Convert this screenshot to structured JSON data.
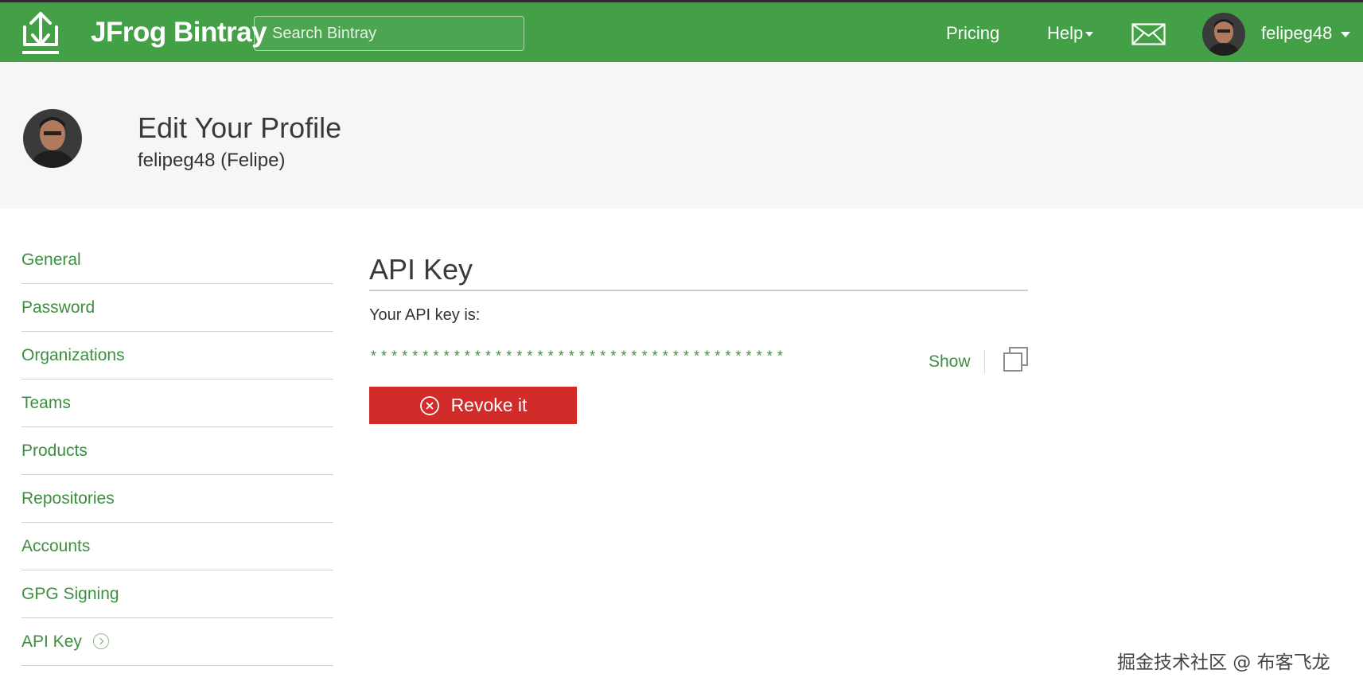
{
  "header": {
    "brand": "JFrog Bintray",
    "search_placeholder": "Search Bintray",
    "pricing": "Pricing",
    "help": "Help",
    "username": "felipeg48",
    "bar_color": "#43a047",
    "icons": [
      "upload-logo-icon",
      "mail-icon",
      "user-avatar",
      "caret-down-icon"
    ]
  },
  "profile": {
    "title": "Edit Your Profile",
    "subtitle": "felipeg48 (Felipe)"
  },
  "sidebar": {
    "items": [
      {
        "label": "General"
      },
      {
        "label": "Password"
      },
      {
        "label": "Organizations"
      },
      {
        "label": "Teams"
      },
      {
        "label": "Products"
      },
      {
        "label": "Repositories"
      },
      {
        "label": "Accounts"
      },
      {
        "label": "GPG Signing"
      },
      {
        "label": "API Key",
        "active": true
      }
    ]
  },
  "panel": {
    "title": "API Key",
    "key_label": "Your API key is:",
    "key_masked": "****************************************",
    "show_label": "Show",
    "revoke_label": "Revoke it",
    "revoke_color": "#d32a2a"
  },
  "watermark": "掘金技术社区 @ 布客飞龙"
}
